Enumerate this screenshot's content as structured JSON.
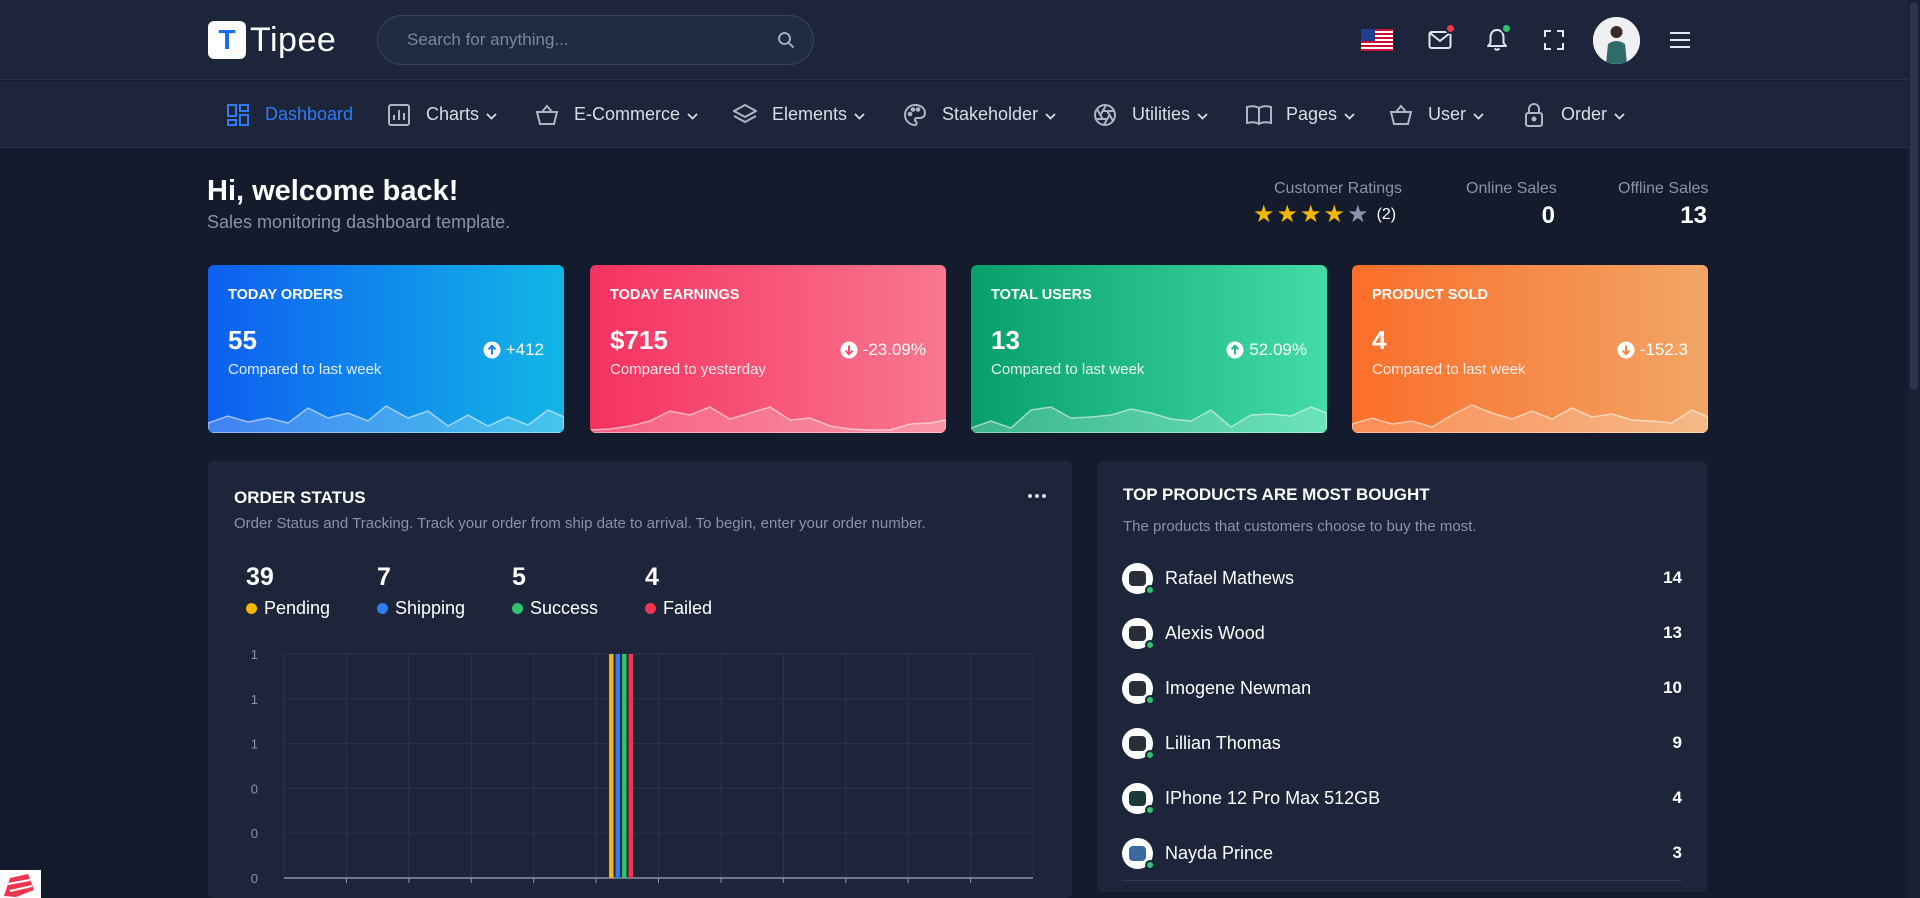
{
  "header": {
    "logo_letter": "T",
    "logo_text": "Tipee",
    "search_placeholder": "Search for anything..."
  },
  "nav": {
    "items": [
      {
        "label": "Dashboard",
        "icon": "dashboard-icon",
        "active": true
      },
      {
        "label": "Charts",
        "icon": "chart-icon"
      },
      {
        "label": "E-Commerce",
        "icon": "basket-icon"
      },
      {
        "label": "Elements",
        "icon": "layers-icon"
      },
      {
        "label": "Stakeholder",
        "icon": "palette-icon"
      },
      {
        "label": "Utilities",
        "icon": "aperture-icon"
      },
      {
        "label": "Pages",
        "icon": "book-icon"
      },
      {
        "label": "User",
        "icon": "basket-icon"
      },
      {
        "label": "Order",
        "icon": "lock-icon"
      }
    ]
  },
  "welcome": {
    "title": "Hi, welcome back!",
    "subtitle": "Sales monitoring dashboard template."
  },
  "stats": {
    "ratings_label": "Customer Ratings",
    "ratings_stars": 4,
    "ratings_count": "(2)",
    "online_label": "Online Sales",
    "online_value": "0",
    "offline_label": "Offline Sales",
    "offline_value": "13"
  },
  "cards": [
    {
      "title": "TODAY ORDERS",
      "value": "55",
      "sub": "Compared to last week",
      "change": "+412",
      "direction": "up",
      "colors": [
        "#0e5ff0",
        "#12b6e6"
      ]
    },
    {
      "title": "TODAY EARNINGS",
      "value": "$715",
      "sub": "Compared to yesterday",
      "change": "-23.09%",
      "direction": "down",
      "colors": [
        "#f5325f",
        "#f97890"
      ]
    },
    {
      "title": "TOTAL USERS",
      "value": "13",
      "sub": "Compared to last week",
      "change": "52.09%",
      "direction": "up",
      "colors": [
        "#07a06a",
        "#43dca6"
      ]
    },
    {
      "title": "PRODUCT SOLD",
      "value": "4",
      "sub": "Compared to last week",
      "change": "-152.3",
      "direction": "down",
      "colors": [
        "#fb6e2a",
        "#f1a666"
      ]
    }
  ],
  "order_status": {
    "title": "ORDER STATUS",
    "subtitle": "Order Status and Tracking. Track your order from ship date to arrival. To begin, enter your order number.",
    "items": [
      {
        "count": "39",
        "label": "Pending",
        "color": "#f5b800"
      },
      {
        "count": "7",
        "label": "Shipping",
        "color": "#2f7cf6"
      },
      {
        "count": "5",
        "label": "Success",
        "color": "#2ec271"
      },
      {
        "count": "4",
        "label": "Failed",
        "color": "#f0364f"
      }
    ]
  },
  "chart_data": {
    "type": "bar",
    "y_tick_labels": [
      "1",
      "1",
      "1",
      "0",
      "0",
      "0"
    ],
    "series": [
      {
        "name": "Pending",
        "color": "#f5b800",
        "values": [
          0,
          0,
          0,
          0,
          0,
          1,
          0,
          0,
          0,
          0,
          0,
          0
        ]
      },
      {
        "name": "Shipping",
        "color": "#2f7cf6",
        "values": [
          0,
          0,
          0,
          0,
          0,
          1,
          0,
          0,
          0,
          0,
          0,
          0
        ]
      },
      {
        "name": "Success",
        "color": "#2ec271",
        "values": [
          0,
          0,
          0,
          0,
          0,
          1,
          0,
          0,
          0,
          0,
          0,
          0
        ]
      },
      {
        "name": "Failed",
        "color": "#f0364f",
        "values": [
          0,
          0,
          0,
          0,
          0,
          1,
          0,
          0,
          0,
          0,
          0,
          0
        ]
      }
    ],
    "ylim": [
      0,
      1
    ],
    "grid": true
  },
  "top_products": {
    "title": "TOP PRODUCTS ARE MOST BOUGHT",
    "subtitle": "The products that customers choose to buy the most.",
    "items": [
      {
        "name": "Rafael Mathews",
        "qty": "14"
      },
      {
        "name": "Alexis Wood",
        "qty": "13"
      },
      {
        "name": "Imogene Newman",
        "qty": "10"
      },
      {
        "name": "Lillian Thomas",
        "qty": "9"
      },
      {
        "name": "IPhone 12 Pro Max 512GB",
        "qty": "4"
      },
      {
        "name": "Nayda Prince",
        "qty": "3"
      }
    ]
  }
}
